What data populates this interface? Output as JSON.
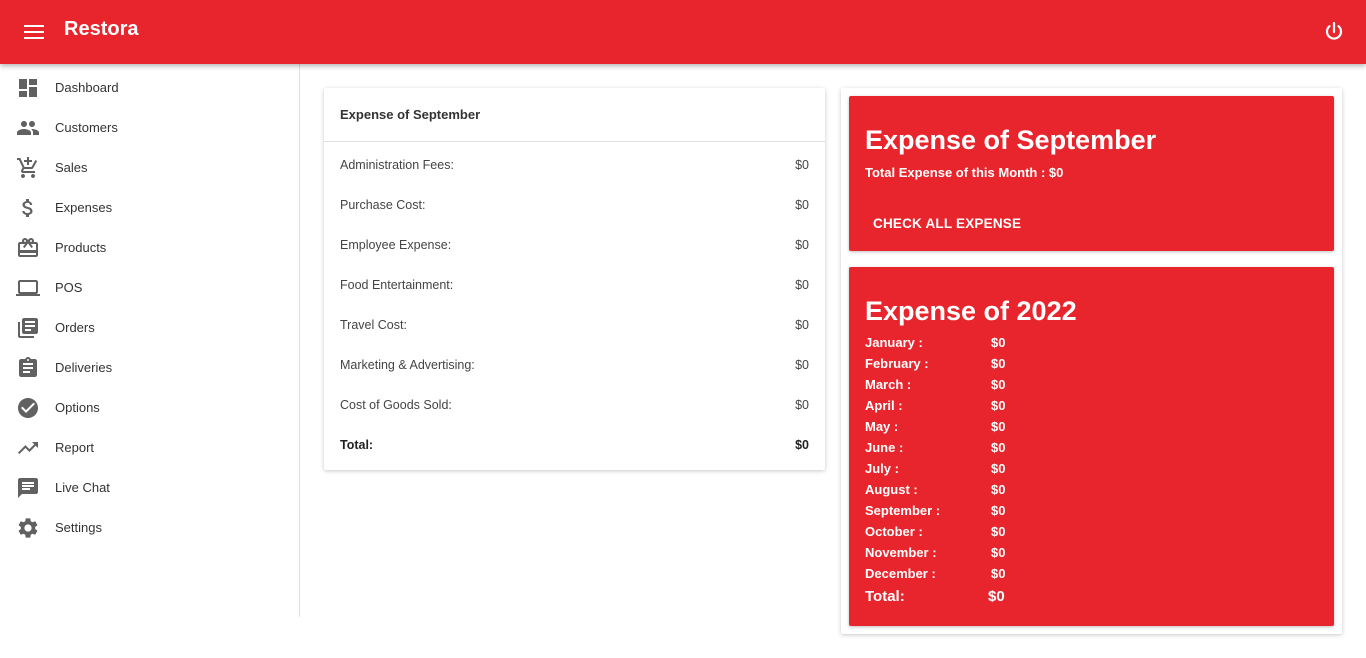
{
  "app": {
    "title": "Restora"
  },
  "sidebar": {
    "items": [
      {
        "label": "Dashboard",
        "icon": "dashboard-icon"
      },
      {
        "label": "Customers",
        "icon": "people-icon"
      },
      {
        "label": "Sales",
        "icon": "cart-add-icon"
      },
      {
        "label": "Expenses",
        "icon": "dollar-icon"
      },
      {
        "label": "Products",
        "icon": "gift-card-icon"
      },
      {
        "label": "POS",
        "icon": "laptop-icon"
      },
      {
        "label": "Orders",
        "icon": "library-books-icon"
      },
      {
        "label": "Deliveries",
        "icon": "clipboard-icon"
      },
      {
        "label": "Options",
        "icon": "check-circle-icon"
      },
      {
        "label": "Report",
        "icon": "trending-up-icon"
      },
      {
        "label": "Live Chat",
        "icon": "chat-icon"
      },
      {
        "label": "Settings",
        "icon": "gear-icon"
      }
    ]
  },
  "month_card": {
    "title": "Expense of September",
    "rows": [
      {
        "label": "Administration Fees:",
        "value": "$0"
      },
      {
        "label": "Purchase Cost:",
        "value": "$0"
      },
      {
        "label": "Employee Expense:",
        "value": "$0"
      },
      {
        "label": "Food Entertainment:",
        "value": "$0"
      },
      {
        "label": "Travel Cost:",
        "value": "$0"
      },
      {
        "label": "Marketing & Advertising:",
        "value": "$0"
      },
      {
        "label": "Cost of Goods Sold:",
        "value": "$0"
      }
    ],
    "total_label": "Total:",
    "total_value": "$0"
  },
  "summary_card": {
    "title": "Expense of September",
    "subtitle": "Total Expense of this Month : $0",
    "button_label": "CHECK ALL EXPENSE"
  },
  "year_card": {
    "title": "Expense of 2022",
    "months": [
      {
        "label": "January :",
        "value": "$0"
      },
      {
        "label": "February :",
        "value": "$0"
      },
      {
        "label": "March :",
        "value": "$0"
      },
      {
        "label": "April :",
        "value": "$0"
      },
      {
        "label": "May :",
        "value": "$0"
      },
      {
        "label": "June :",
        "value": "$0"
      },
      {
        "label": "July :",
        "value": "$0"
      },
      {
        "label": "August :",
        "value": "$0"
      },
      {
        "label": "September :",
        "value": "$0"
      },
      {
        "label": "October :",
        "value": "$0"
      },
      {
        "label": "November :",
        "value": "$0"
      },
      {
        "label": "December :",
        "value": "$0"
      }
    ],
    "total_label": "Total:",
    "total_value": "$0"
  },
  "colors": {
    "accent": "#e8252d",
    "icon": "#616161"
  }
}
